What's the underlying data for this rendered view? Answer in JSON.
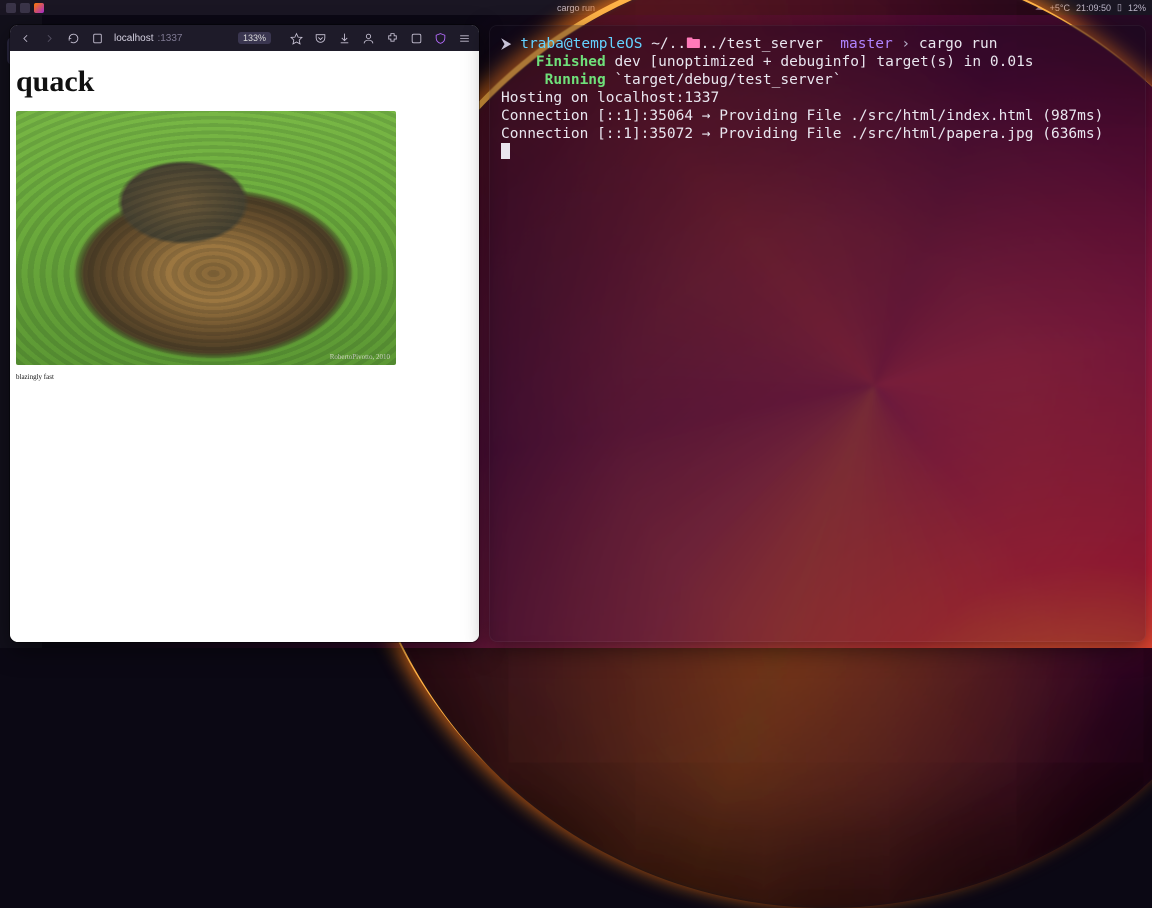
{
  "sysbar": {
    "window_title": "cargo run",
    "weather_icon": "☁",
    "temperature": "+5°C",
    "clock": "21:09:50",
    "battery_icon": "▯",
    "battery_pct": "12%"
  },
  "browser": {
    "url_host": "localhost",
    "url_port": ":1337",
    "zoom": "133%",
    "page": {
      "heading": "quack",
      "caption": "blazingly fast",
      "image_watermark": "RobertoPivotto, 2010"
    },
    "icons": {
      "back": "back-icon",
      "forward": "forward-icon",
      "reload": "reload-icon",
      "site_info": "site-info-icon",
      "star": "star-icon",
      "pocket": "pocket-icon",
      "download": "download-icon",
      "account": "account-icon",
      "extensions": "extensions-icon",
      "adblock": "adblock-icon",
      "shield": "shield-icon",
      "menu": "menu-icon"
    }
  },
  "terminal": {
    "prompt_glyph": "⮞",
    "user": "traba",
    "at": "@",
    "host": "templeOS",
    "path_prefix": "~/..",
    "folder_glyph": "🖿",
    "path_rest": "../test_server",
    "branch_glyph": "",
    "branch": "master",
    "prompt_sep": "›",
    "command": "cargo run",
    "lines": {
      "finished_label": "Finished",
      "finished_rest": " dev [unoptimized + debuginfo] target(s) in 0.01s",
      "running_label": "Running",
      "running_rest": " `target/debug/test_server`",
      "hosting": "Hosting on localhost:1337",
      "conn1": "Connection [::1]:35064 → Providing File ./src/html/index.html (987ms)",
      "conn2": "Connection [::1]:35072 → Providing File ./src/html/papera.jpg (636ms)"
    }
  }
}
